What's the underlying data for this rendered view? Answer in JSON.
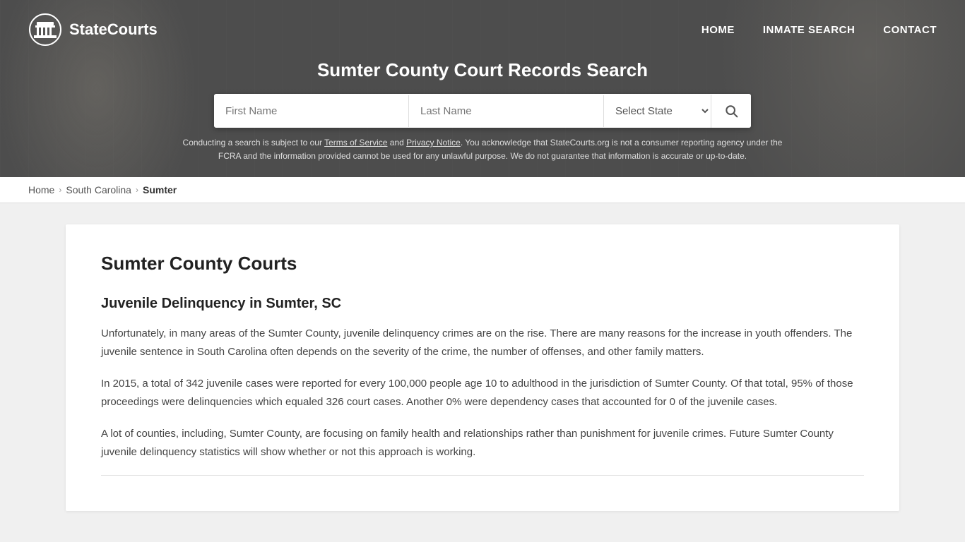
{
  "site": {
    "logo_text_bold": "State",
    "logo_text_normal": "Courts",
    "nav": {
      "home": "HOME",
      "inmate_search": "INMATE SEARCH",
      "contact": "CONTACT"
    }
  },
  "header": {
    "title": "Sumter County Court Records Search",
    "search": {
      "first_name_placeholder": "First Name",
      "last_name_placeholder": "Last Name",
      "state_placeholder": "Select State",
      "button_label": "Search"
    },
    "disclaimer": "Conducting a search is subject to our Terms of Service and Privacy Notice. You acknowledge that StateCourts.org is not a consumer reporting agency under the FCRA and the information provided cannot be used for any unlawful purpose. We do not guarantee that information is accurate or up-to-date."
  },
  "breadcrumb": {
    "home": "Home",
    "state": "South Carolina",
    "county": "Sumter"
  },
  "main": {
    "page_title": "Sumter County Courts",
    "sections": [
      {
        "title": "Juvenile Delinquency in Sumter, SC",
        "paragraphs": [
          "Unfortunately, in many areas of the Sumter County, juvenile delinquency crimes are on the rise. There are many reasons for the increase in youth offenders. The juvenile sentence in South Carolina often depends on the severity of the crime, the number of offenses, and other family matters.",
          "In 2015, a total of 342 juvenile cases were reported for every 100,000 people age 10 to adulthood in the jurisdiction of Sumter County. Of that total, 95% of those proceedings were delinquencies which equaled 326 court cases. Another 0% were dependency cases that accounted for 0 of the juvenile cases.",
          "A lot of counties, including, Sumter County, are focusing on family health and relationships rather than punishment for juvenile crimes. Future Sumter County juvenile delinquency statistics will show whether or not this approach is working."
        ]
      }
    ]
  }
}
